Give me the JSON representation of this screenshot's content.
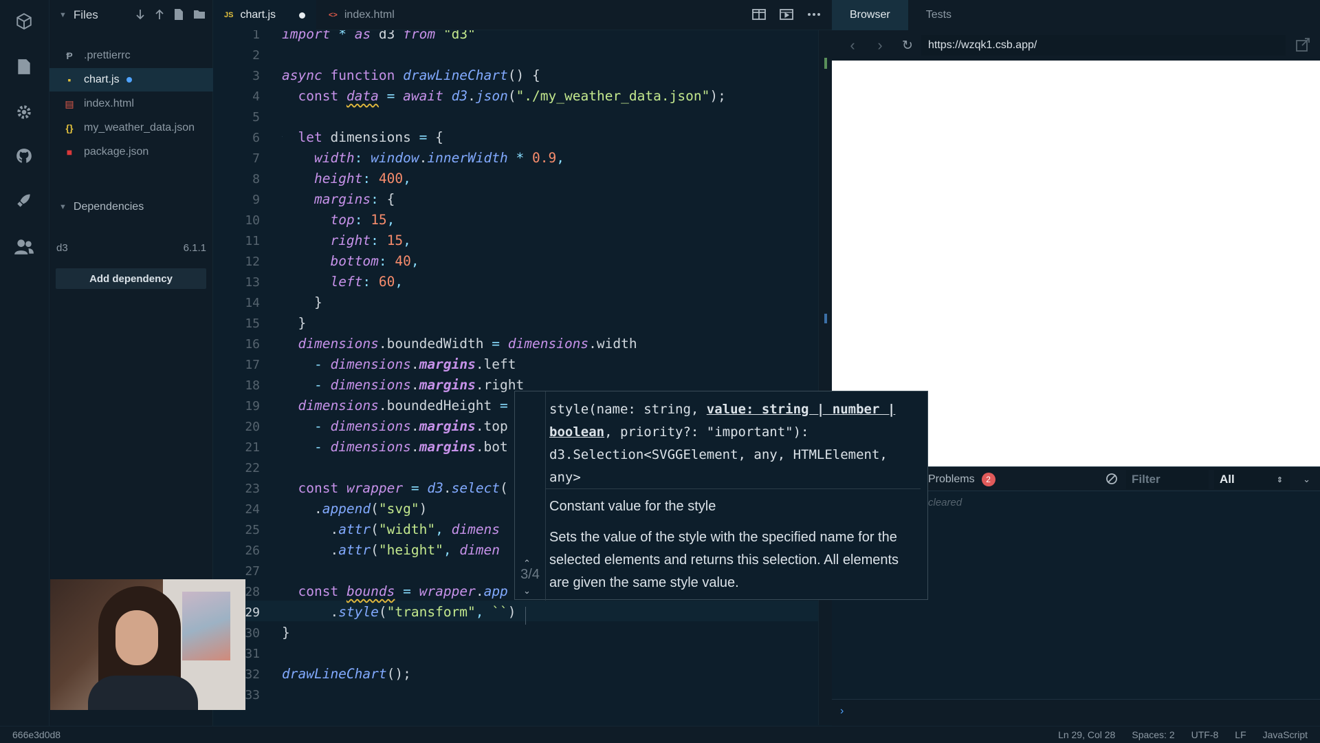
{
  "sidebar": {
    "title": "Files",
    "files": [
      {
        "name": ".prettierrc",
        "icon": "prettier-icon",
        "color": "#8c99a4"
      },
      {
        "name": "chart.js",
        "icon": "js-icon",
        "color": "#e2c13d"
      },
      {
        "name": "index.html",
        "icon": "html-icon",
        "color": "#e05a4a"
      },
      {
        "name": "my_weather_data.json",
        "icon": "json-icon",
        "color": "#e2c13d"
      },
      {
        "name": "package.json",
        "icon": "npm-icon",
        "color": "#d9383a"
      }
    ],
    "dependencies_title": "Dependencies",
    "dependency": {
      "name": "d3",
      "version": "6.1.1"
    },
    "add_dependency": "Add dependency"
  },
  "editor": {
    "tabs": [
      {
        "label": "chart.js",
        "icon": "JS"
      },
      {
        "label": "index.html",
        "icon": "<>"
      }
    ],
    "line_numbers": [
      "1",
      "2",
      "3",
      "4",
      "5",
      "6",
      "7",
      "8",
      "9",
      "10",
      "11",
      "12",
      "13",
      "14",
      "15",
      "16",
      "17",
      "18",
      "19",
      "20",
      "21",
      "22",
      "23",
      "24",
      "25",
      "26",
      "27",
      "28",
      "29",
      "30",
      "31",
      "32",
      "33"
    ]
  },
  "tooltip": {
    "sig_a": "style(name: string, ",
    "sig_b": "value: string | number | boolean",
    "sig_c": ", priority?: \"important\"): d3.Selection<SVGGElement, any, HTMLElement, any>",
    "doc_title": "Constant value for the style",
    "doc_body": "Sets the value of the style with the specified name for the selected elements and returns this selection. All elements are given the same style value.",
    "overload": "3/4"
  },
  "browser": {
    "tabs": [
      "Browser",
      "Tests"
    ],
    "url": "https://wzqk1.csb.app/",
    "console": {
      "problems_label": "Problems",
      "problems_count": "2",
      "filter_placeholder": "Filter",
      "level": "All",
      "cleared_text": "cleared"
    }
  },
  "status": {
    "sandbox_id": "666e3d0d8",
    "position": "Ln 29, Col 28",
    "spaces": "Spaces: 2",
    "encoding": "UTF-8",
    "eol": "LF",
    "language": "JavaScript"
  },
  "colors": {
    "background": "#0d1e2b",
    "accent": "#4fa3ff",
    "keyword": "#c792ea",
    "string": "#c3e88d",
    "number": "#f78c6c"
  }
}
